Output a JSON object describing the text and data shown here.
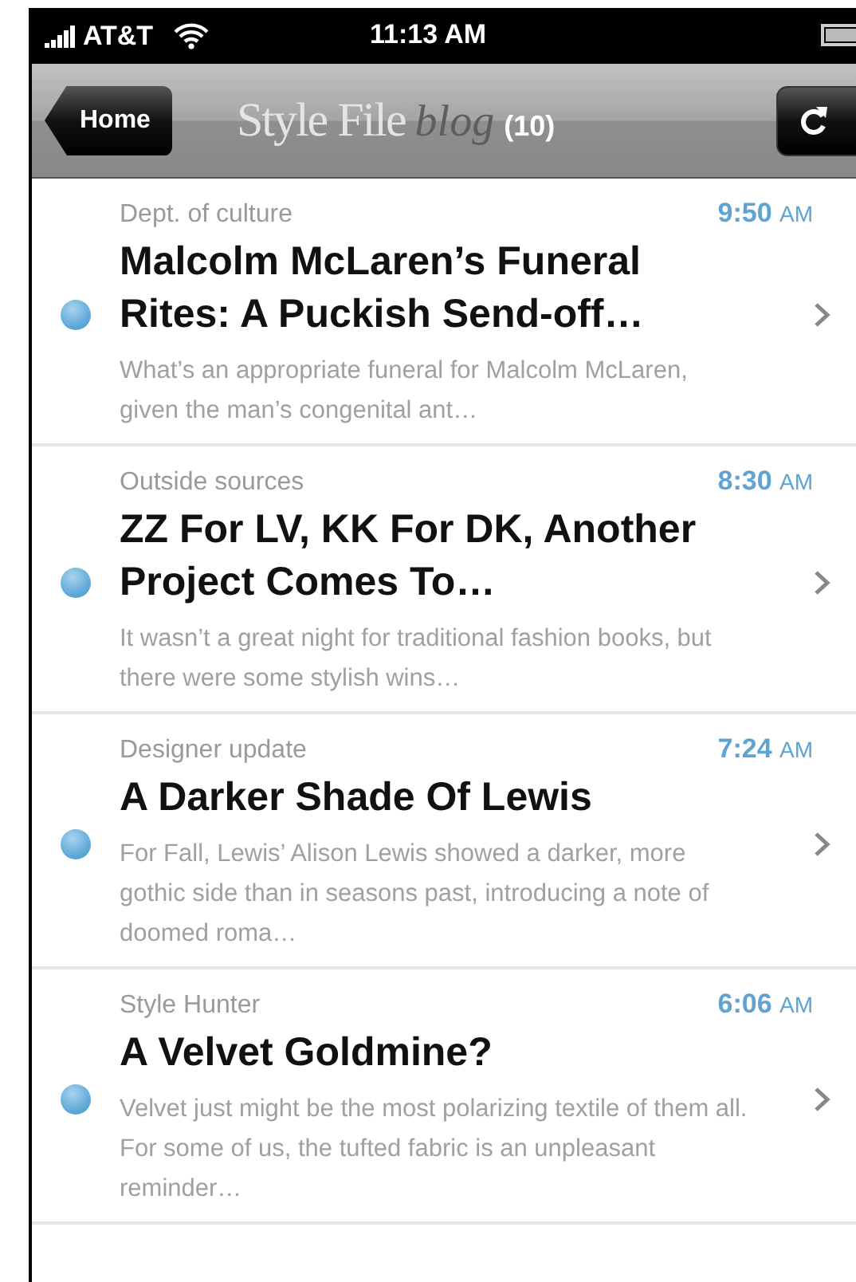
{
  "status_bar": {
    "carrier": "AT&T",
    "time": "11:13 AM"
  },
  "nav_bar": {
    "back_button": "Home",
    "title": "Style File",
    "title_tag": "blog",
    "count": "(10)"
  },
  "articles": [
    {
      "category": "Dept. of culture",
      "time": "9:50",
      "period": "AM",
      "title": "Malcolm McLaren’s Funeral Rites: A Puckish Send-off…",
      "excerpt": "What’s an appropriate funeral for Malcolm McLaren, given the man’s congenital ant…",
      "unread": true
    },
    {
      "category": "Outside sources",
      "time": "8:30",
      "period": "AM",
      "title": "ZZ For LV, KK For DK, Another Project Comes To…",
      "excerpt": "It wasn’t a great night for traditional fashion books, but there were some stylish wins…",
      "unread": true
    },
    {
      "category": "Designer update",
      "time": "7:24",
      "period": "AM",
      "title": "A Darker Shade Of Lewis",
      "excerpt": "For Fall, Lewis’ Alison Lewis showed a darker, more gothic side than in seasons past, introducing a note of doomed roma…",
      "unread": true
    },
    {
      "category": "Style Hunter",
      "time": "6:06",
      "period": "AM",
      "title": "A Velvet Goldmine?",
      "excerpt": "Velvet just might be the most polarizing textile of them all. For some of us, the tufted fabric is an unpleasant reminder…",
      "unread": true
    }
  ]
}
